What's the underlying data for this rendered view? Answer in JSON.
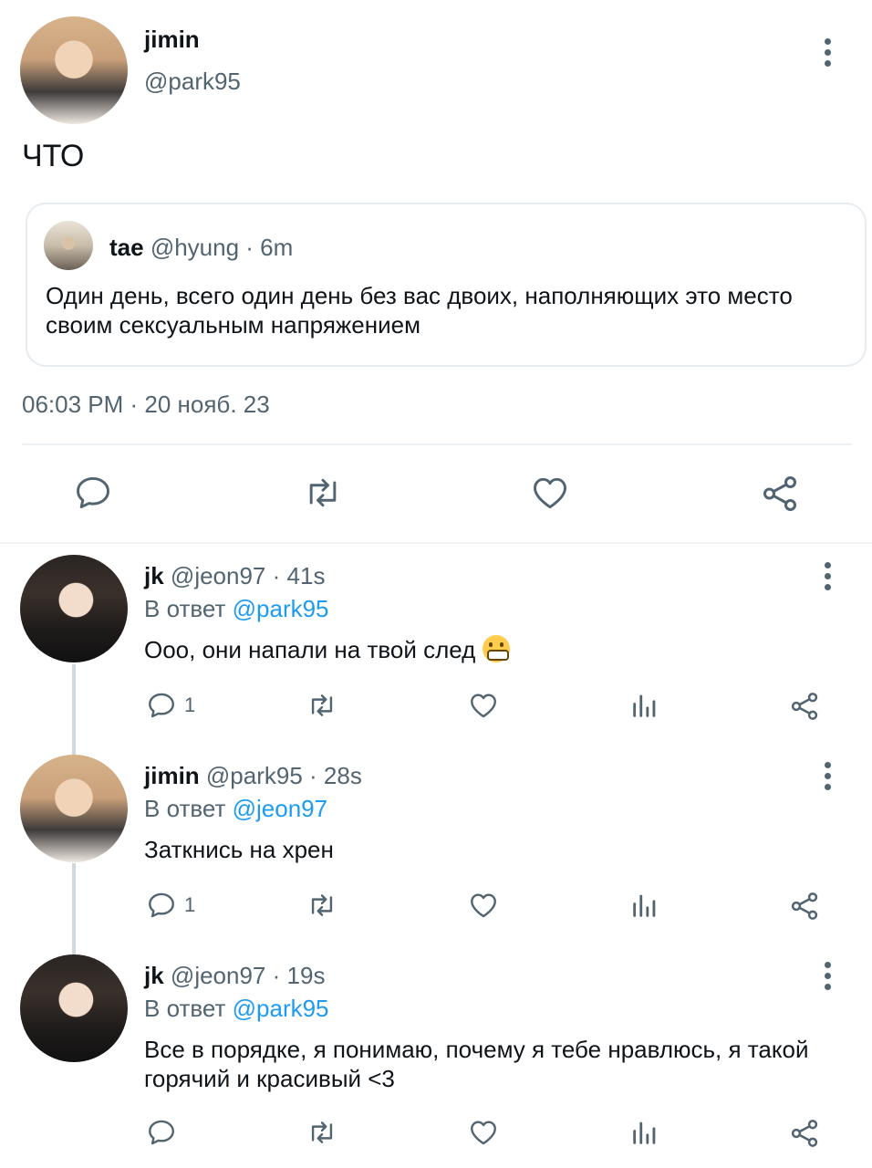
{
  "main_tweet": {
    "author_name": "jimin",
    "author_handle": "@park95",
    "text": "ЧТО",
    "timestamp": "06:03 PM · 20 нояб. 23",
    "quote": {
      "author_name": "tae",
      "author_handle": "@hyung",
      "time": "· 6m",
      "text": "Один день, всего один день без вас двоих, наполняющих это место своим сексуальным напряжением"
    }
  },
  "replies": [
    {
      "author_name": "jk",
      "author_handle": "@jeon97",
      "time": "· 41s",
      "reply_prefix": "В ответ",
      "reply_to": "@park95",
      "text": "Ооо, они напали на твой след",
      "reply_count": "1",
      "emoji": "grimacing-face"
    },
    {
      "author_name": "jimin",
      "author_handle": "@park95",
      "time": "· 28s",
      "reply_prefix": "В ответ",
      "reply_to": "@jeon97",
      "text": "Заткнись на хрен",
      "reply_count": "1"
    },
    {
      "author_name": "jk",
      "author_handle": "@jeon97",
      "time": "· 19s",
      "reply_prefix": "В ответ",
      "reply_to": "@park95",
      "text": "Все в порядке, я понимаю, почему я тебе нравлюсь, я такой горячий и красивый <3",
      "reply_count": ""
    }
  ],
  "colors": {
    "text": "#0f1419",
    "secondary": "#536471",
    "link": "#1d9bf0",
    "border": "#e6ecf0"
  }
}
